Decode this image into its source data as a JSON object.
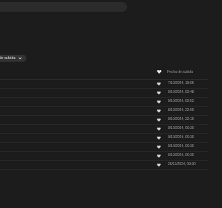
{
  "search": {
    "placeholder": ""
  },
  "sort": {
    "label": "a de subida",
    "icon": "chevron-down-icon"
  },
  "table": {
    "columns": {
      "liked_icon": "heart-icon",
      "date_header": "Fecha de subida"
    },
    "rows": [
      {
        "liked_icon": "heart-icon",
        "date": "7/10/2024, 19:06"
      },
      {
        "liked_icon": "heart-icon",
        "date": "9/10/2024, 02:48"
      },
      {
        "liked_icon": "heart-icon",
        "date": "9/10/2024, 02:52"
      },
      {
        "liked_icon": "heart-icon",
        "date": "8/10/2024, 22:09"
      },
      {
        "liked_icon": "heart-icon",
        "date": "9/10/2024, 22:19"
      },
      {
        "liked_icon": "heart-icon",
        "date": "9/10/2024, 00:30"
      },
      {
        "liked_icon": "heart-icon",
        "date": "9/10/2024, 00:30"
      },
      {
        "liked_icon": "heart-icon",
        "date": "9/10/2024, 00:30"
      },
      {
        "liked_icon": "heart-icon",
        "date": "9/10/2024, 00:30"
      },
      {
        "liked_icon": "heart-icon",
        "date": "26/11/2024, 09:30"
      }
    ]
  },
  "colors": {
    "background": "#1c1c1c",
    "search_bar": "#2b2b2b",
    "chip": "#333333",
    "icon": "#e8e8e8",
    "text_muted": "#9c9c9c"
  }
}
